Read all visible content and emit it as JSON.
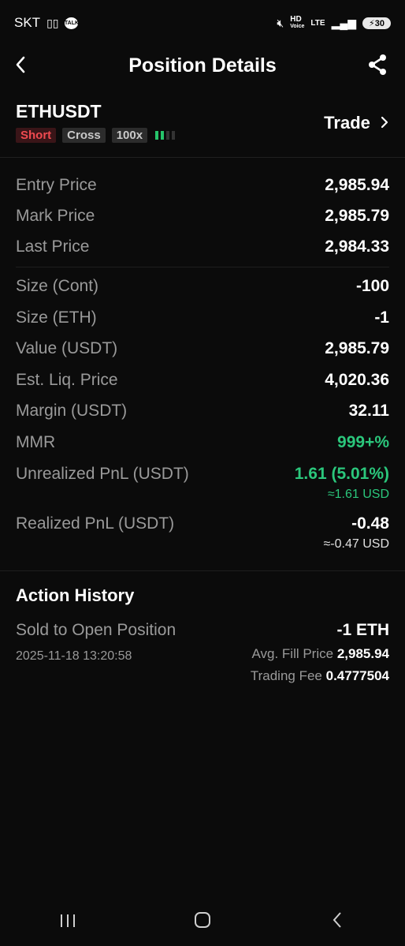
{
  "status_bar": {
    "carrier": "SKT",
    "kakao_badge": "TALK",
    "hd_label": "HD",
    "voice_label": "Voice",
    "lte_label": "LTE",
    "battery": "30"
  },
  "header": {
    "title": "Position Details"
  },
  "position": {
    "symbol": "ETHUSDT",
    "side": "Short",
    "margin_mode": "Cross",
    "leverage": "100x",
    "trade_label": "Trade"
  },
  "prices": [
    {
      "label": "Entry Price",
      "value": "2,985.94"
    },
    {
      "label": "Mark Price",
      "value": "2,985.79"
    },
    {
      "label": "Last Price",
      "value": "2,984.33"
    }
  ],
  "details": [
    {
      "label": "Size (Cont)",
      "value": "-100"
    },
    {
      "label": "Size (ETH)",
      "value": "-1"
    },
    {
      "label": "Value (USDT)",
      "value": "2,985.79"
    },
    {
      "label": "Est. Liq. Price",
      "value": "4,020.36"
    },
    {
      "label": "Margin (USDT)",
      "value": "32.11"
    },
    {
      "label": "MMR",
      "value": "999+%"
    },
    {
      "label": "Unrealized PnL (USDT)",
      "value": "1.61 (5.01%)",
      "sub": "≈1.61 USD"
    },
    {
      "label": "Realized PnL (USDT)",
      "value": "-0.48",
      "sub": "≈-0.47 USD"
    }
  ],
  "action_history": {
    "title": "Action History",
    "items": [
      {
        "description": "Sold to Open Position",
        "datetime": "2025-11-18 13:20:58",
        "amount": "-1 ETH",
        "avg_fill_label": "Avg. Fill Price",
        "avg_fill_value": "2,985.94",
        "fee_label": "Trading Fee",
        "fee_value": "0.4777504"
      }
    ]
  },
  "colors": {
    "background": "#0b0b0b",
    "positive": "#2bc77c",
    "short": "#f04a50"
  }
}
